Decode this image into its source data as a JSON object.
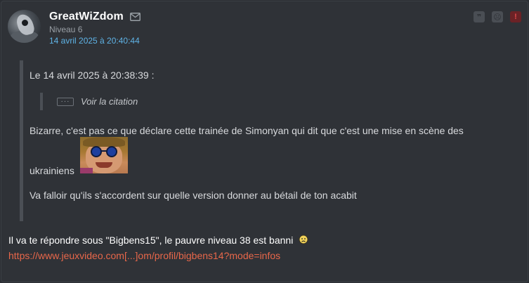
{
  "author": {
    "username": "GreatWiZdom",
    "level": "Niveau 6",
    "post_date": "14 avril 2025 à 20:40:44"
  },
  "toolbar": {
    "icons": [
      "quote-icon",
      "smiley-icon",
      "report-icon"
    ],
    "quote_glyph": "❞",
    "smiley_glyph": "☹",
    "report_glyph": "!"
  },
  "quote": {
    "header": "Le 14 avril 2025 à 20:38:39 :",
    "inner_quote_dots": "···",
    "inner_quote_label": "Voir la citation",
    "line1": "Bizarre, c'est pas ce que déclare cette trainée de Simonyan qui dit que c'est une mise en scène des",
    "line2": "ukrainiens",
    "line3": "Va falloir qu'ils s'accordent sur quelle version donner au bétail de ton acabit"
  },
  "message": {
    "text": "Il va te répondre sous \"Bigbens15\", le pauvre niveau 38 est banni",
    "link": "https://www.jeuxvideo.com[...]om/profil/bigbens14?mode=infos"
  },
  "colors": {
    "background": "#2f3237",
    "date_link": "#5fb3e6",
    "url_link": "#e8674a",
    "report": "#e04a4a"
  }
}
